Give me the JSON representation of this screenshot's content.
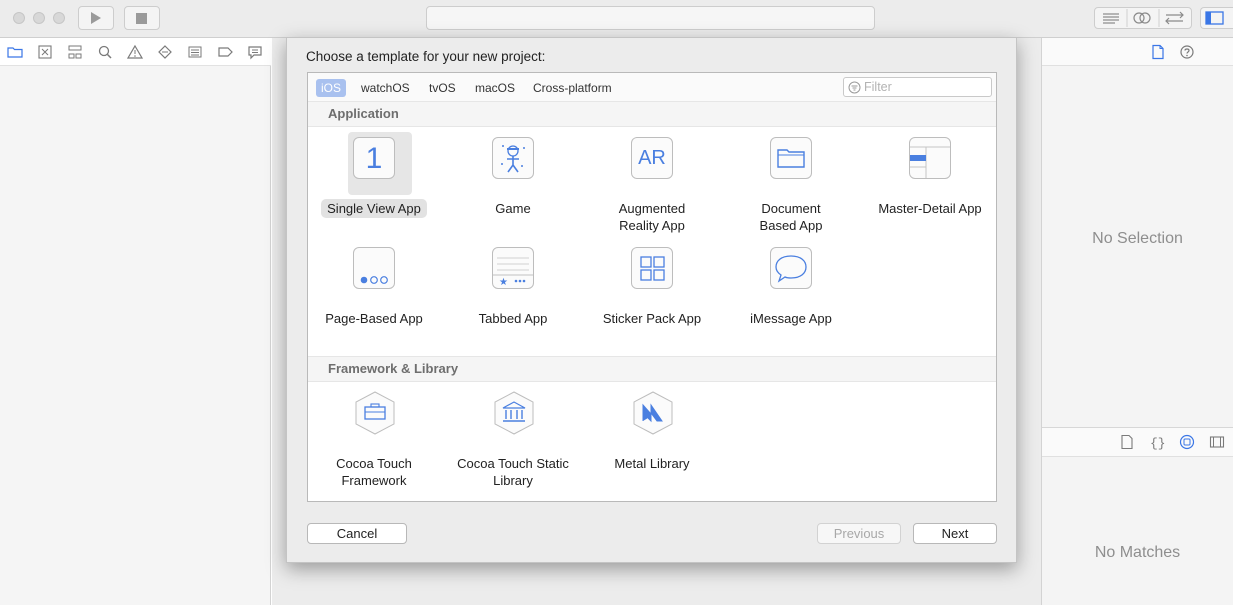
{
  "sheet": {
    "title": "Choose a template for your new project:",
    "platform_tabs": [
      {
        "label": "iOS",
        "active": true
      },
      {
        "label": "watchOS",
        "active": false
      },
      {
        "label": "tvOS",
        "active": false
      },
      {
        "label": "macOS",
        "active": false
      },
      {
        "label": "Cross-platform",
        "active": false
      }
    ],
    "filter": {
      "placeholder": "Filter",
      "value": ""
    },
    "sections": [
      {
        "title": "Application",
        "templates": [
          {
            "label": "Single View App",
            "icon": "single-view-app-icon",
            "selected": true
          },
          {
            "label": "Game",
            "icon": "game-icon"
          },
          {
            "label": "Augmented Reality App",
            "icon": "ar-app-icon"
          },
          {
            "label": "Document Based App",
            "icon": "document-app-icon"
          },
          {
            "label": "Master-Detail App",
            "icon": "master-detail-icon"
          },
          {
            "label": "Page-Based App",
            "icon": "page-based-icon"
          },
          {
            "label": "Tabbed App",
            "icon": "tabbed-app-icon"
          },
          {
            "label": "Sticker Pack App",
            "icon": "sticker-pack-icon"
          },
          {
            "label": "iMessage App",
            "icon": "imessage-icon"
          }
        ]
      },
      {
        "title": "Framework & Library",
        "templates": [
          {
            "label": "Cocoa Touch Framework",
            "icon": "framework-icon"
          },
          {
            "label": "Cocoa Touch Static Library",
            "icon": "static-library-icon"
          },
          {
            "label": "Metal Library",
            "icon": "metal-library-icon"
          }
        ]
      }
    ],
    "buttons": {
      "cancel": "Cancel",
      "previous": "Previous",
      "next": "Next"
    },
    "icon_glyphs": {
      "single_view": "1",
      "ar": "AR"
    }
  },
  "inspector": {
    "no_selection": "No Selection",
    "no_matches": "No Matches"
  },
  "colors": {
    "accent": "#3a76e6",
    "tab_selected": "#a9c1ef",
    "icon_stroke": "#4a7fe0"
  }
}
